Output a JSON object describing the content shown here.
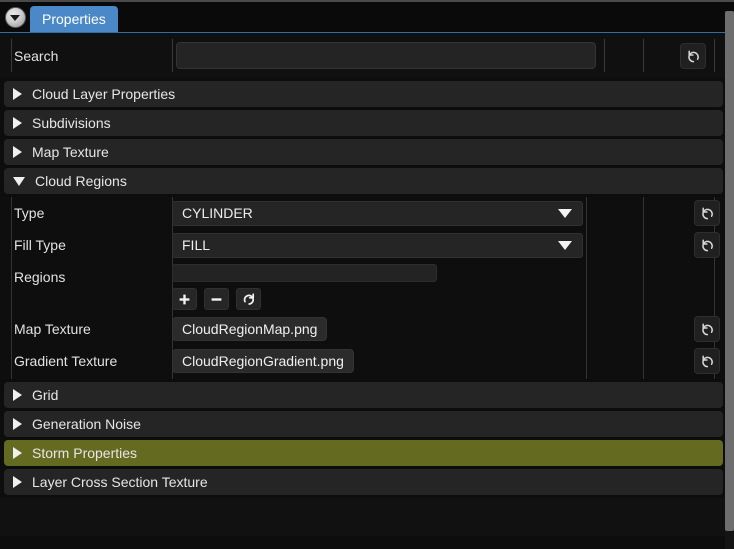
{
  "window": {
    "tab_label": "Properties",
    "menu_icon": "dropdown-circle-icon",
    "accent_color": "#4a88c7",
    "highlight_color": "#646a20",
    "panel_background": "#0d0d0d"
  },
  "search": {
    "label": "Search",
    "value": "",
    "placeholder": "",
    "revert_icon": "revert-arrow-icon"
  },
  "sections": [
    {
      "label": "Cloud Layer Properties",
      "expanded": false,
      "highlighted": false
    },
    {
      "label": "Subdivisions",
      "expanded": false,
      "highlighted": false
    },
    {
      "label": "Map Texture",
      "expanded": false,
      "highlighted": false
    },
    {
      "label": "Cloud Regions",
      "expanded": true,
      "highlighted": false
    },
    {
      "label": "Grid",
      "expanded": false,
      "highlighted": false
    },
    {
      "label": "Generation Noise",
      "expanded": false,
      "highlighted": false
    },
    {
      "label": "Storm Properties",
      "expanded": false,
      "highlighted": true
    },
    {
      "label": "Layer Cross Section Texture",
      "expanded": false,
      "highlighted": false
    }
  ],
  "cloud_regions": {
    "type_row": {
      "label": "Type",
      "value": "CYLINDER",
      "options": [
        "CYLINDER"
      ],
      "caret_icon": "chevron-down-icon",
      "revert_icon": "revert-arrow-icon"
    },
    "fill_type_row": {
      "label": "Fill Type",
      "value": "FILL",
      "options": [
        "FILL"
      ],
      "caret_icon": "chevron-down-icon",
      "revert_icon": "revert-arrow-icon"
    },
    "regions_row": {
      "label": "Regions",
      "value": "",
      "add_label": "+",
      "remove_label": "−",
      "reset_icon": "refresh-icon"
    },
    "map_texture_row": {
      "label": "Map Texture",
      "value": "CloudRegionMap.png",
      "revert_icon": "revert-arrow-icon"
    },
    "gradient_texture_row": {
      "label": "Gradient Texture",
      "value": "CloudRegionGradient.png",
      "revert_icon": "revert-arrow-icon"
    }
  }
}
